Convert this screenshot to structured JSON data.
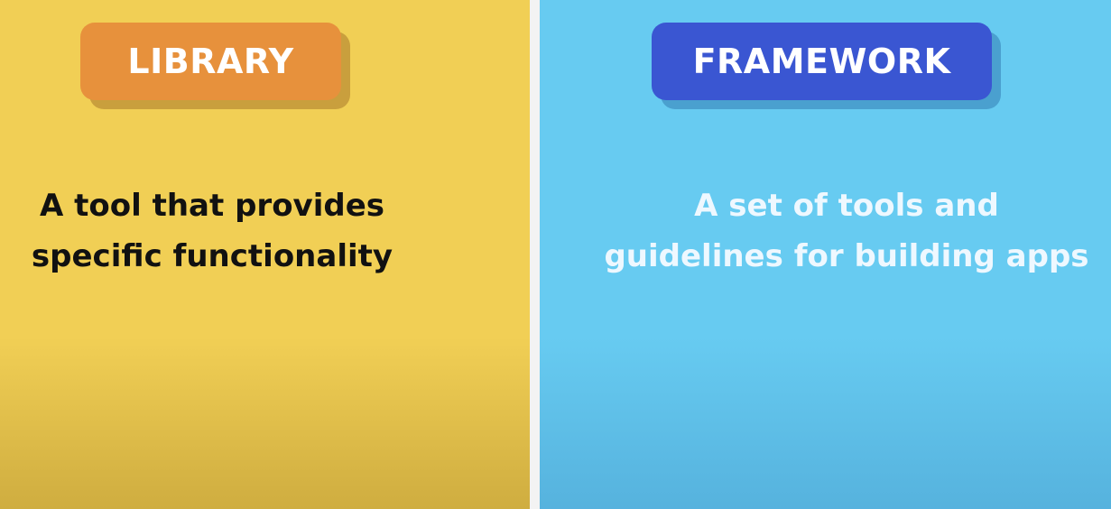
{
  "library": {
    "badge_label": "LIBRARY",
    "description_line1": "A tool that provides",
    "description_line2": "specific functionality"
  },
  "framework": {
    "badge_label": "FRAMEWORK",
    "description_line1": "A set of tools and",
    "description_line2": "guidelines for building apps"
  },
  "colors": {
    "library_panel": "#f1cf55",
    "library_badge": "#e7913c",
    "framework_panel": "#67cbf1",
    "framework_badge": "#3a56d2",
    "divider": "#f3f3f3"
  }
}
